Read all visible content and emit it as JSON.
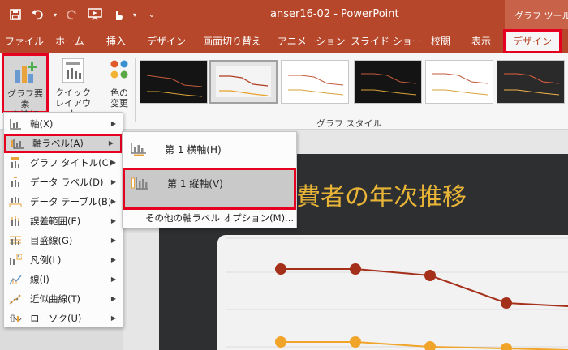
{
  "window": {
    "title": "anser16-02 - PowerPoint",
    "context_header": "グラフ ツール"
  },
  "qat": {
    "save_icon": "save-icon",
    "undo_icon": "undo-icon",
    "redo_icon": "redo-icon",
    "present_icon": "present-from-start-icon",
    "touch_icon": "touch-mode-icon",
    "customize_icon": "customize-qat-icon"
  },
  "tabs": [
    {
      "label": "ファイル"
    },
    {
      "label": "ホーム"
    },
    {
      "label": "挿入"
    },
    {
      "label": "デザイン"
    },
    {
      "label": "画面切り替え"
    },
    {
      "label": "アニメーション"
    },
    {
      "label": "スライド ショー"
    },
    {
      "label": "校閲"
    },
    {
      "label": "表示"
    },
    {
      "label": "デザイン"
    }
  ],
  "ribbon": {
    "add_element_line1": "グラフ要素",
    "add_element_line2": "を追加",
    "quick_layout_line1": "クイック",
    "quick_layout_line2": "レイアウト",
    "change_color_line1": "色の",
    "change_color_line2": "変更",
    "chart_styles_label": "グラフ スタイル"
  },
  "menu": {
    "items": [
      {
        "label": "軸(X)",
        "icon": "axes-icon"
      },
      {
        "label": "軸ラベル(A)",
        "icon": "axis-titles-icon"
      },
      {
        "label": "グラフ タイトル(C)",
        "icon": "chart-title-icon"
      },
      {
        "label": "データ ラベル(D)",
        "icon": "data-labels-icon"
      },
      {
        "label": "データ テーブル(B)",
        "icon": "data-table-icon"
      },
      {
        "label": "誤差範囲(E)",
        "icon": "error-bars-icon"
      },
      {
        "label": "目盛線(G)",
        "icon": "gridlines-icon"
      },
      {
        "label": "凡例(L)",
        "icon": "legend-icon"
      },
      {
        "label": "線(I)",
        "icon": "lines-icon"
      },
      {
        "label": "近似曲線(T)",
        "icon": "trendline-icon"
      },
      {
        "label": "ローソク(U)",
        "icon": "up-down-bars-icon"
      }
    ]
  },
  "submenu": {
    "primary_horizontal": "第 1 横軸(H)",
    "primary_vertical": "第 1 縦軸(V)",
    "more_options": "その他の軸ラベル オプション(M)..."
  },
  "slide": {
    "title_visible": "費者の年次推移"
  },
  "colors": {
    "accent": "#b7472a",
    "highlight_box": "#e5001f",
    "series1": "#a5301a",
    "series2": "#f0a52a",
    "slide_title": "#e8b437"
  }
}
